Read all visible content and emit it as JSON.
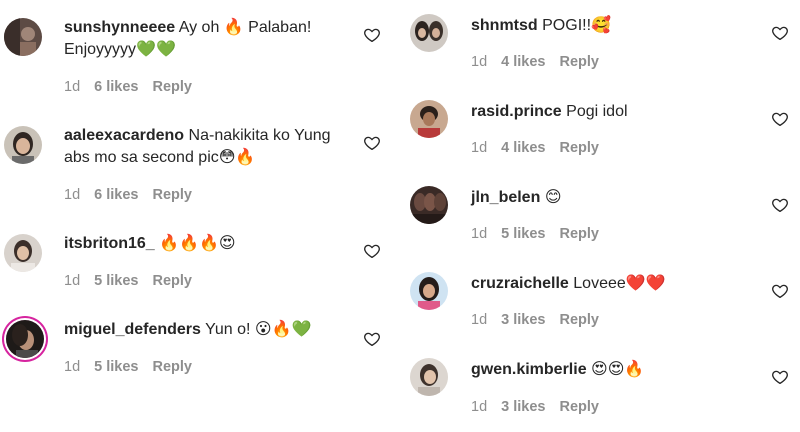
{
  "left_comments": [
    {
      "username": "sunshynneeee",
      "text": "Ay oh 🔥 Palaban! Enjoyyyyy💚💚",
      "time": "1d",
      "likes": "6 likes",
      "reply": "Reply"
    },
    {
      "username": "aaleexacardeno",
      "text": "Na-nakikita ko Yung abs mo sa second pic😳🔥",
      "time": "1d",
      "likes": "6 likes",
      "reply": "Reply"
    },
    {
      "username": "itsbriton16_",
      "text": "🔥🔥🔥😍",
      "time": "1d",
      "likes": "5 likes",
      "reply": "Reply"
    },
    {
      "username": "miguel_defenders",
      "text": "Yun o! 😮🔥💚",
      "time": "1d",
      "likes": "5 likes",
      "reply": "Reply"
    }
  ],
  "right_comments": [
    {
      "username": "shnmtsd",
      "text": "POGI!!🥰",
      "time": "1d",
      "likes": "4 likes",
      "reply": "Reply"
    },
    {
      "username": "rasid.prince",
      "text": "Pogi idol",
      "time": "1d",
      "likes": "4 likes",
      "reply": "Reply"
    },
    {
      "username": "jln_belen",
      "text": "😊",
      "time": "1d",
      "likes": "5 likes",
      "reply": "Reply"
    },
    {
      "username": "cruzraichelle",
      "text": "Loveee❤️❤️",
      "time": "1d",
      "likes": "3 likes",
      "reply": "Reply"
    },
    {
      "username": "gwen.kimberlie",
      "text": "😍😍🔥",
      "time": "1d",
      "likes": "3 likes",
      "reply": "Reply"
    }
  ],
  "colors": {
    "text": "#262626",
    "meta": "#8e8e8e",
    "story_ring": "#d6249f"
  },
  "icons": {
    "like": "heart-outline-icon"
  }
}
